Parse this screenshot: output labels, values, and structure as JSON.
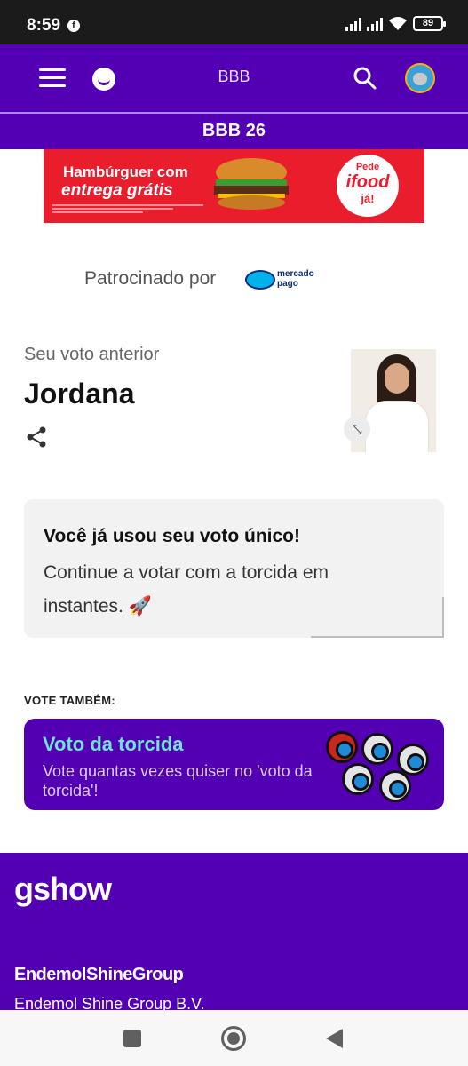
{
  "status_bar": {
    "time": "8:59",
    "battery": "89",
    "app_icon": "facebook-icon"
  },
  "header": {
    "title": "BBB",
    "subtitle": "BBB 26"
  },
  "ad": {
    "line1": "Hambúrguer com",
    "line2": "entrega grátis",
    "badge_top": "Pede",
    "badge_brand": "ifood",
    "badge_bottom": "já!"
  },
  "sponsor": {
    "label": "Patrocinado por",
    "logo_text_1": "mercado",
    "logo_text_2": "pago"
  },
  "previous_vote": {
    "label": "Seu voto anterior",
    "name": "Jordana"
  },
  "notice": {
    "title": "Você já usou seu voto único!",
    "body": "Continue a votar com a torcida em instantes. 🚀"
  },
  "vote_also": {
    "label": "VOTE TAMBÉM:",
    "card_title": "Voto da torcida",
    "card_subtitle": "Vote quantas vezes quiser no 'voto da torcida'!"
  },
  "footer": {
    "brand": "gshow",
    "partner_logo": "EndemolShineGroup",
    "partner_name": "Endemol Shine Group B.V."
  },
  "colors": {
    "brand_purple": "#5300b4",
    "accent_teal": "#6fe3d4",
    "ad_red": "#ea1d2c"
  }
}
